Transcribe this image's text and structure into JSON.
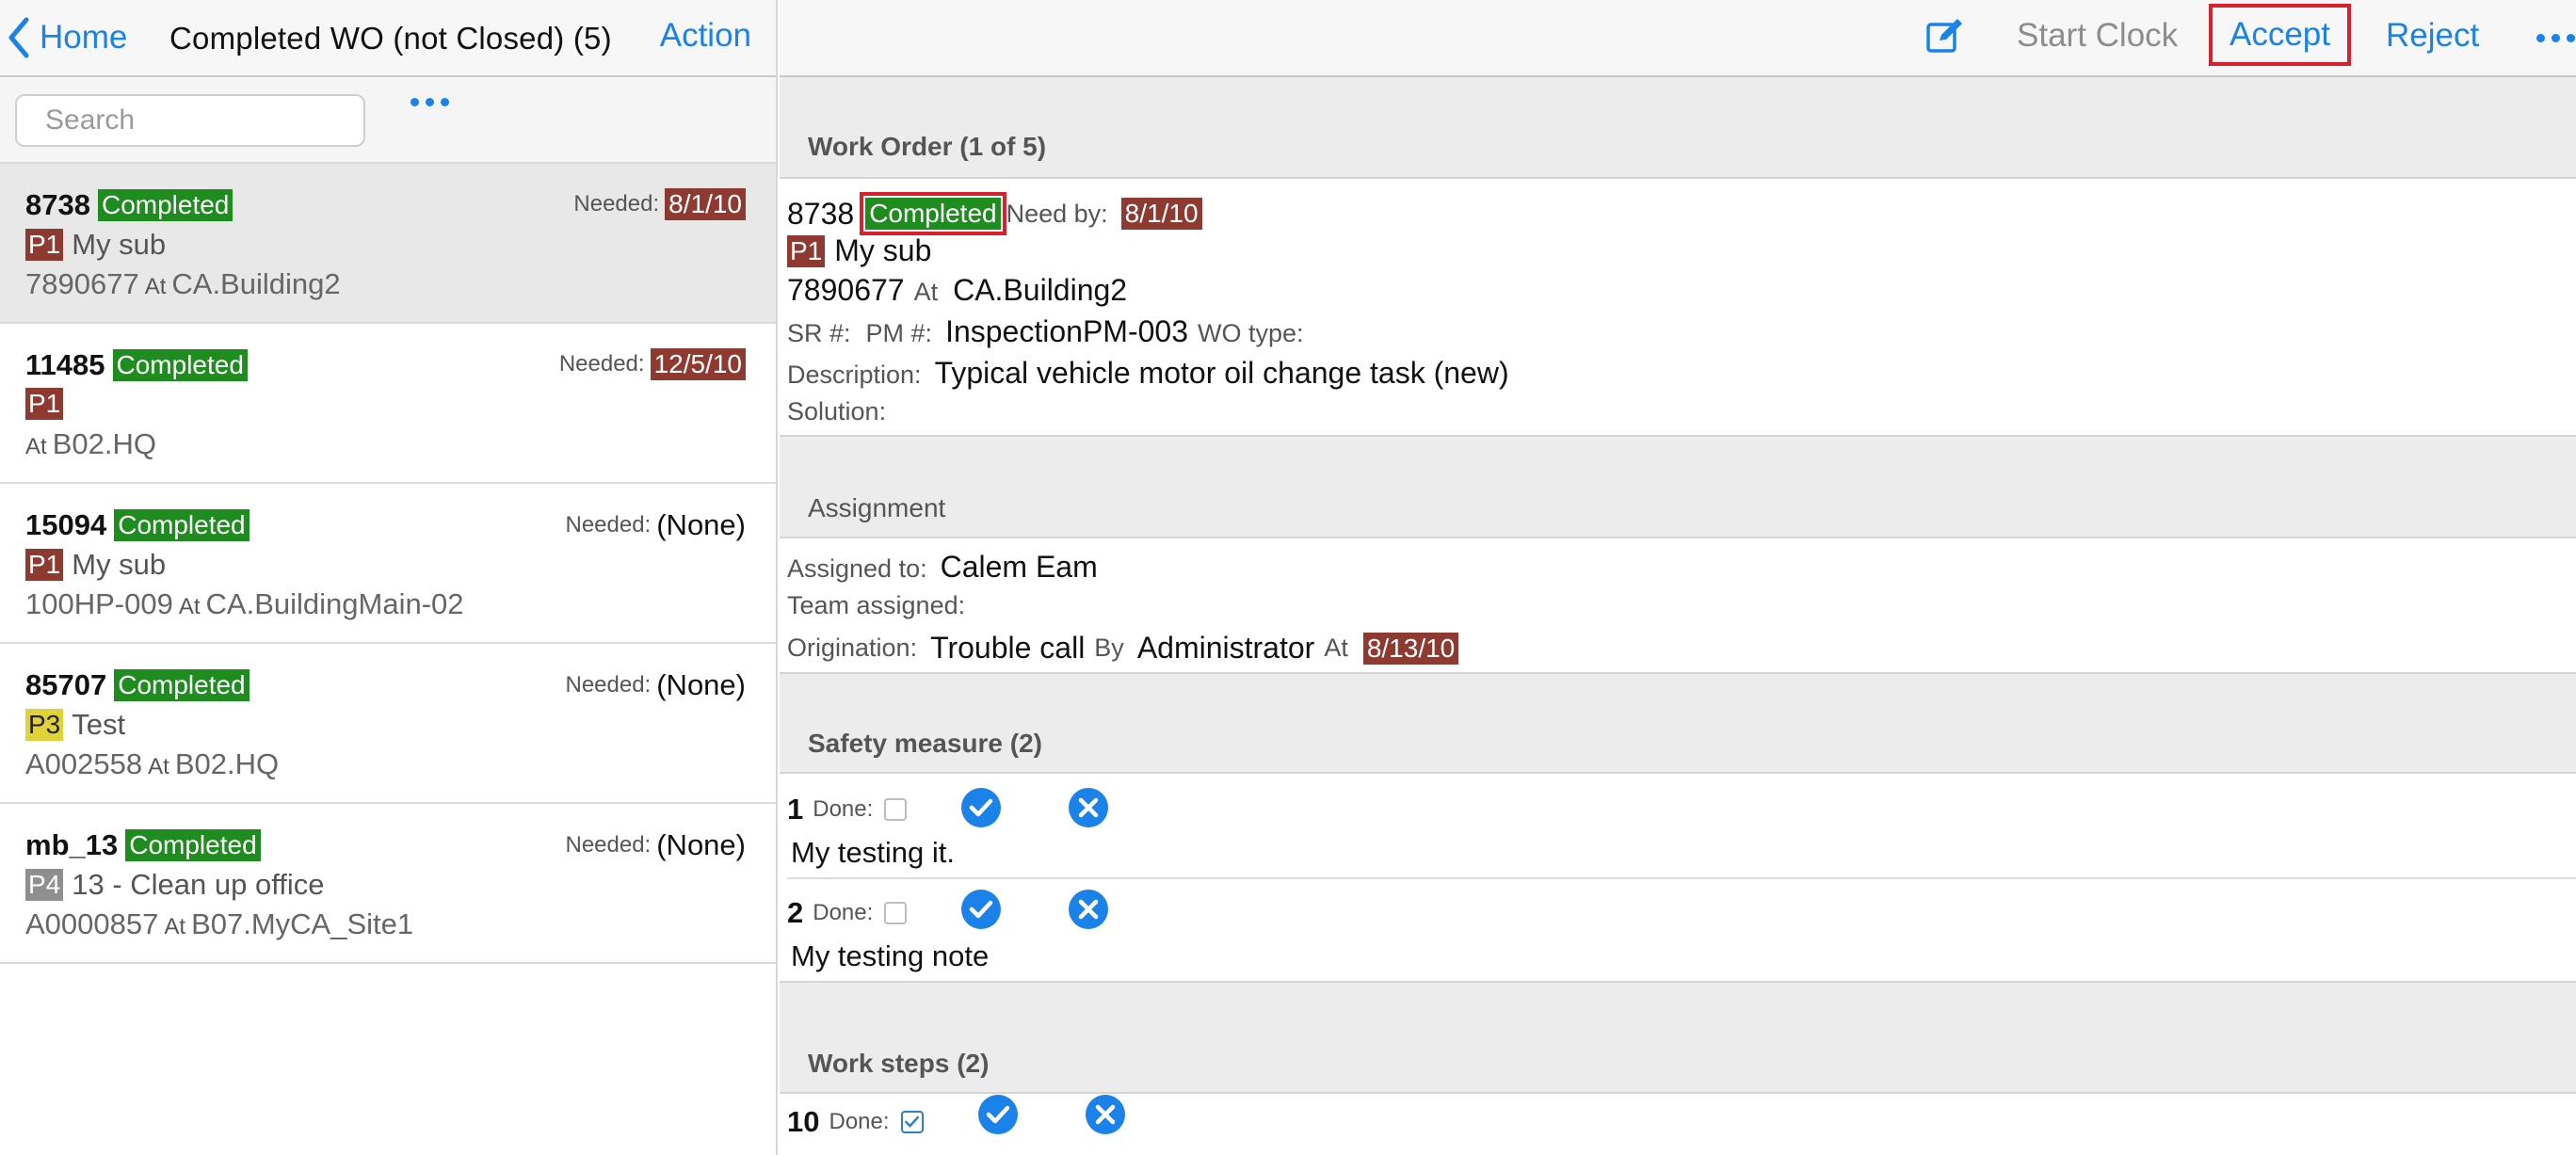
{
  "left_header": {
    "home_label": "Home",
    "title": "Completed WO (not Closed) (5)",
    "action_label": "Action"
  },
  "search": {
    "placeholder": "Search"
  },
  "wo_list": [
    {
      "number": "8738",
      "status": "Completed",
      "needed_label": "Needed:",
      "needed": "8/1/10",
      "priority": "P1",
      "desc": "My sub",
      "asset": "7890677",
      "at_label": "At",
      "location": "CA.Building2"
    },
    {
      "number": "11485",
      "status": "Completed",
      "needed_label": "Needed:",
      "needed": "12/5/10",
      "priority": "P1",
      "desc": "",
      "asset": "",
      "at_label": "At",
      "location": "B02.HQ"
    },
    {
      "number": "15094",
      "status": "Completed",
      "needed_label": "Needed:",
      "needed": "(None)",
      "priority": "P1",
      "desc": "My sub",
      "asset": "100HP-009",
      "at_label": "At",
      "location": "CA.BuildingMain-02"
    },
    {
      "number": "85707",
      "status": "Completed",
      "needed_label": "Needed:",
      "needed": "(None)",
      "priority": "P3",
      "desc": "Test",
      "asset": "A002558",
      "at_label": "At",
      "location": "B02.HQ"
    },
    {
      "number": "mb_13",
      "status": "Completed",
      "needed_label": "Needed:",
      "needed": "(None)",
      "priority": "P4",
      "desc": "13 - Clean up office",
      "asset": "A0000857",
      "at_label": "At",
      "location": "B07.MyCA_Site1"
    }
  ],
  "toolbar": {
    "start_clock": "Start Clock",
    "accept": "Accept",
    "reject": "Reject"
  },
  "work_order": {
    "section_title": "Work Order (1 of 5)",
    "number": "8738",
    "status": "Completed",
    "need_by_label": "Need by:",
    "need_by": "8/1/10",
    "priority": "P1",
    "desc": "My sub",
    "asset": "7890677",
    "at_label": "At",
    "location": "CA.Building2",
    "sr_label": "SR #:",
    "pm_label": "PM #:",
    "pm": "InspectionPM-003",
    "wo_type_label": "WO type:",
    "description_label": "Description:",
    "description": "Typical vehicle motor oil change task (new)",
    "solution_label": "Solution:"
  },
  "assignment": {
    "section_title": "Assignment",
    "assigned_to_label": "Assigned to:",
    "assigned_to": "Calem Eam",
    "team_label": "Team assigned:",
    "origination_label": "Origination:",
    "origination": "Trouble call",
    "by_label": "By",
    "by": "Administrator",
    "at_label": "At",
    "at_date": "8/13/10"
  },
  "safety": {
    "section_title": "Safety measure (2)",
    "items": [
      {
        "num": "1",
        "done_label": "Done:",
        "note": "My testing it."
      },
      {
        "num": "2",
        "done_label": "Done:",
        "note": "My testing note"
      }
    ]
  },
  "steps": {
    "section_title": "Work steps (2)",
    "items": [
      {
        "num": "10",
        "done_label": "Done:"
      }
    ]
  },
  "colors": {
    "accent": "#1a82e8",
    "completed": "#1f8c1f",
    "date_badge": "#8f3a31",
    "p3": "#e1d13a",
    "p4": "#8f8f8f",
    "highlight": "#d9202b"
  }
}
